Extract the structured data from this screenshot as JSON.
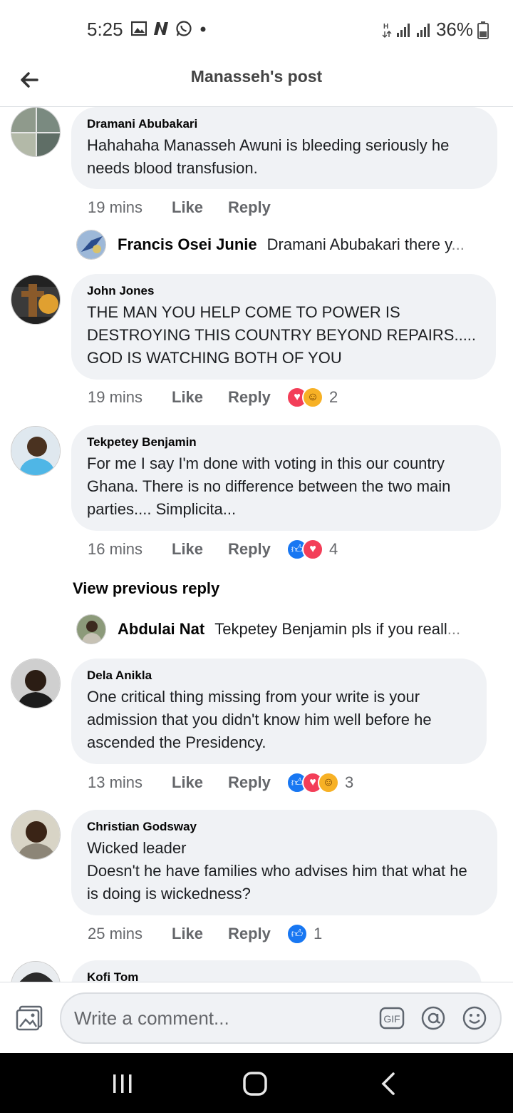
{
  "status_bar": {
    "time": "5:25",
    "battery": "36%"
  },
  "header": {
    "title": "Manasseh's post"
  },
  "comments": [
    {
      "name": "Dramani Abubakari",
      "text": "Hahahaha Manasseh Awuni is bleeding seriously he needs blood transfusion.",
      "time": "19 mins",
      "like": "Like",
      "reply": "Reply"
    },
    {
      "name": "John Jones",
      "text": "THE MAN YOU HELP COME TO POWER IS DESTROYING THIS COUNTRY BEYOND REPAIRS..... GOD IS WATCHING BOTH OF YOU",
      "time": "19 mins",
      "like": "Like",
      "reply": "Reply",
      "reaction_count": "2"
    },
    {
      "name": "Tekpetey Benjamin",
      "text": "For me I say I'm done with voting in this our country Ghana. There is no difference between the two main parties.... Simplicita...",
      "time": "16 mins",
      "like": "Like",
      "reply": "Reply",
      "reaction_count": "4"
    },
    {
      "name": "Dela Anikla",
      "text": "One critical thing missing from your write is your admission that you didn't know him well before he ascended the Presidency.",
      "time": "13 mins",
      "like": "Like",
      "reply": "Reply",
      "reaction_count": "3"
    },
    {
      "name": "Christian Godsway",
      "text": "Wicked leader\nDoesn't he have families who advises him that what he is doing is wickedness?",
      "time": "25 mins",
      "like": "Like",
      "reply": "Reply",
      "reaction_count": "1"
    },
    {
      "name": "Kofi Tom"
    }
  ],
  "replies": [
    {
      "name": "Francis Osei Junie",
      "text": "Dramani Abubakari there y",
      "ellipsis": "..."
    },
    {
      "name": "Abdulai Nat",
      "text": "Tekpetey Benjamin pls if you reall",
      "ellipsis": "..."
    }
  ],
  "view_previous_reply": "View previous reply",
  "composer": {
    "placeholder": "Write a comment...",
    "gif": "GIF"
  }
}
